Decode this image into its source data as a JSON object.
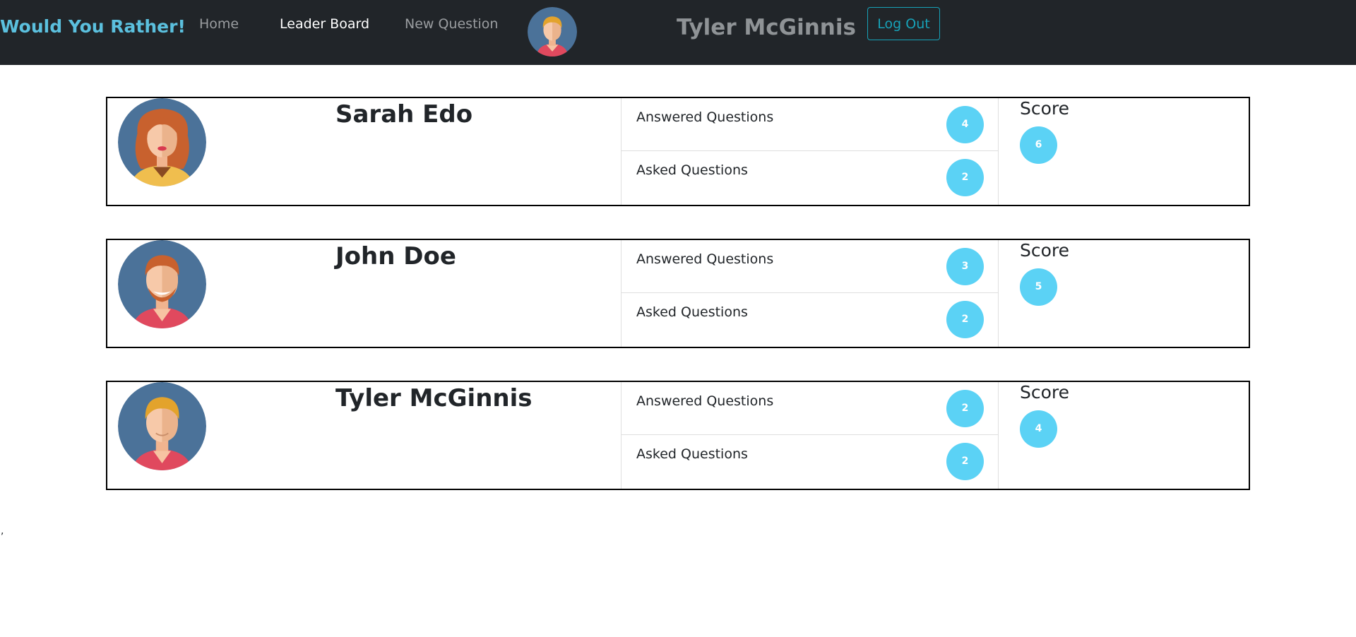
{
  "navbar": {
    "brand": "Would You Rather!",
    "links": [
      "Home",
      "Leader Board",
      "New Question"
    ],
    "active_link": "Leader Board",
    "current_user": "Tyler McGinnis",
    "logout_label": "Log Out"
  },
  "leaderboard": [
    {
      "name": "Sarah Edo",
      "avatar": "female-avatar-red-hair",
      "answered_label": "Answered Questions",
      "answered": "4",
      "asked_label": "Asked Questions",
      "asked": "2",
      "score_label": "Score",
      "score": "6"
    },
    {
      "name": "John Doe",
      "avatar": "male-avatar-beard",
      "answered_label": "Answered Questions",
      "answered": "3",
      "asked_label": "Asked Questions",
      "asked": "2",
      "score_label": "Score",
      "score": "5"
    },
    {
      "name": "Tyler McGinnis",
      "avatar": "male-avatar-blond",
      "answered_label": "Answered Questions",
      "answered": "2",
      "asked_label": "Asked Questions",
      "asked": "2",
      "score_label": "Score",
      "score": "4"
    }
  ],
  "stray_text": ",",
  "colors": {
    "navbar_bg": "#212529",
    "brand": "#5bc0de",
    "badge": "#5bd2f5",
    "logout_border": "#17a2b8",
    "avatar_bg": "#4b7299"
  }
}
